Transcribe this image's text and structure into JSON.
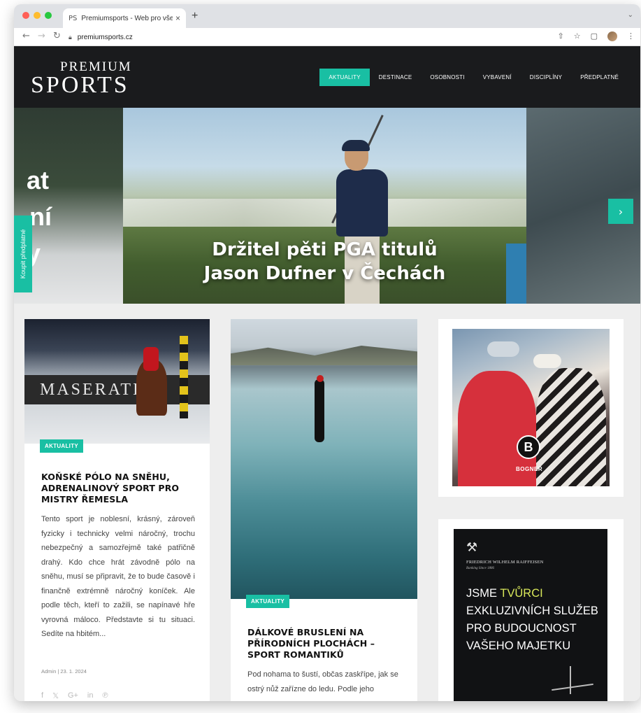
{
  "browser": {
    "tab_title": "Premiumsports - Web pro všem",
    "tab_favicon": "PS",
    "new_tab": "+",
    "url": "premiumsports.cz",
    "traffic_lights": [
      "#ff5f57",
      "#febc2e",
      "#28c840"
    ]
  },
  "site": {
    "logo_top": "PREMIUM",
    "logo_bottom": "SPORTS",
    "menu": [
      {
        "label": "AKTUALITY",
        "active": true
      },
      {
        "label": "DESTINACE",
        "active": false
      },
      {
        "label": "OSOBNOSTI",
        "active": false
      },
      {
        "label": "VYBAVENÍ",
        "active": false
      },
      {
        "label": "DISCIPLÍNY",
        "active": false
      },
      {
        "label": "PŘEDPLATNÉ",
        "active": false
      }
    ],
    "accent_color": "#19bfa3"
  },
  "hero": {
    "left_partial_text": [
      "at",
      "ní",
      "ny"
    ],
    "side_tab_label": "Koupit předplatné",
    "title_line1": "Držitel pěti PGA titulů",
    "title_line2": "Jason Dufner v Čechách",
    "next_arrow": "›"
  },
  "articles": [
    {
      "tag": "AKTUALITY",
      "image_text": "MASERATI",
      "title": "KOŇSKÉ PÓLO NA SNĚHU, ADRENALINOVÝ SPORT PRO MISTRY ŘEMESLA",
      "excerpt": "Tento sport je noblesní, krásný, zároveň fyzicky i technicky velmi náročný, trochu nebezpečný a samozřejmě také patřičně drahý. Kdo chce hrát závodně pólo na sněhu, musí se připravit, že to bude časově i finančně extrémně náročný koníček. Ale podle těch, kteří to zažili, se napínavé hře vyrovná máloco. Představte si tu situaci. Sedíte na hbitém...",
      "meta": "Admin | 23. 1. 2024",
      "social": [
        "f",
        "𝕏",
        "G+",
        "in",
        "℗"
      ]
    },
    {
      "tag": "AKTUALITY",
      "title": "DÁLKOVÉ BRUSLENÍ NA PŘÍRODNÍCH PLOCHÁCH – SPORT ROMANTIKŮ",
      "excerpt": "Pod nohama to šustí, občas zaskřípe, jak se ostrý nůž zařízne do ledu. Podle jeho"
    }
  ],
  "ads": {
    "bogner_label": "BOGNER",
    "bogner_logo": "B",
    "raiffeisen_icon": "⚒",
    "raiffeisen_name": "FRIEDRICH WILHELM RAIFFEISEN",
    "raiffeisen_sub": "Banking Since 1886",
    "raiffeisen_line1_a": "JSME ",
    "raiffeisen_line1_b": "TVŮRCI",
    "raiffeisen_line2": "EXKLUZIVNÍCH SLUŽEB",
    "raiffeisen_line3": "PRO BUDOUCNOST",
    "raiffeisen_line4": "VAŠEHO MAJETKU"
  }
}
